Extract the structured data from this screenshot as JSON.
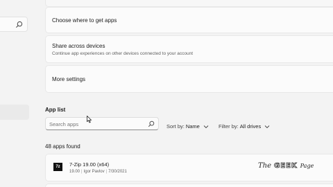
{
  "nav": {
    "search_icon": "search-icon"
  },
  "settings": {
    "choose_title": "Choose where to get apps",
    "share_title": "Share across devices",
    "share_subtitle": "Continue app experiences on other devices connected to your account",
    "more_title": "More settings"
  },
  "app_list": {
    "section_title": "App list",
    "search_placeholder": "Search apps",
    "sort_label": "Sort by:",
    "sort_value": "Name",
    "filter_label": "Filter by:",
    "filter_value": "All drives",
    "count_text": "48 apps found"
  },
  "apps": [
    {
      "icon_text": "7z",
      "name": "7-Zip 19.00 (x64)",
      "version": "19.00",
      "publisher": "Igor Pavlov",
      "date": "7/30/2021"
    }
  ],
  "watermark": {
    "the": "The",
    "geek": "GEEK",
    "page": "Page"
  },
  "colors": {
    "background": "#f3f3f3",
    "card": "#fbfbfb"
  }
}
